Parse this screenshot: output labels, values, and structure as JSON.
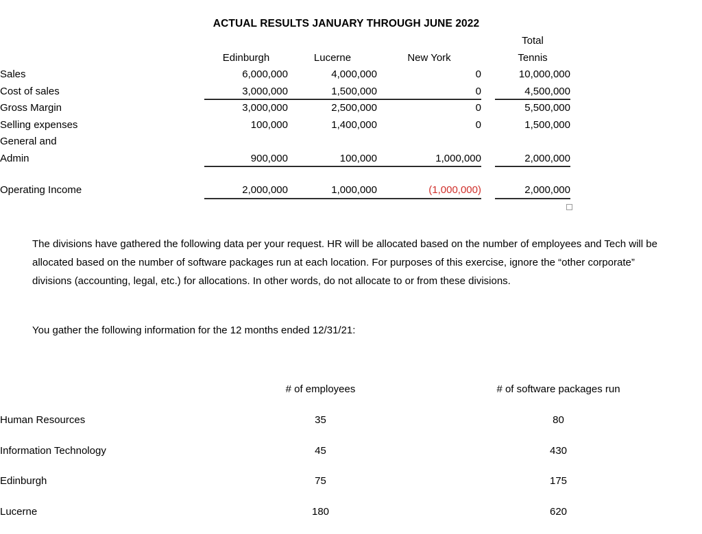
{
  "document": {
    "title": "ACTUAL RESULTS JANUARY THROUGH JUNE 2022"
  },
  "financial_table": {
    "headers": {
      "label": "",
      "edinburgh": "Edinburgh",
      "lucerne": "Lucerne",
      "new_york": "New York",
      "total_line1": "Total",
      "total_line2": "Tennis"
    },
    "rows": [
      {
        "label": "Sales",
        "edinburgh": "6,000,000",
        "lucerne": "4,000,000",
        "new_york": "0",
        "total": "10,000,000",
        "underline": false,
        "negative": false
      },
      {
        "label": "Cost of sales",
        "edinburgh": "3,000,000",
        "lucerne": "1,500,000",
        "new_york": "0",
        "total": "4,500,000",
        "underline": true,
        "negative": false
      },
      {
        "label": "Gross Margin",
        "edinburgh": "3,000,000",
        "lucerne": "2,500,000",
        "new_york": "0",
        "total": "5,500,000",
        "underline": false,
        "negative": false
      },
      {
        "label": "Selling expenses",
        "edinburgh": "100,000",
        "lucerne": "1,400,000",
        "new_york": "0",
        "total": "1,500,000",
        "underline": false,
        "negative": false
      },
      {
        "label": "General and",
        "edinburgh": "",
        "lucerne": "",
        "new_york": "",
        "total": "",
        "underline": false,
        "negative": false
      },
      {
        "label": "Admin",
        "edinburgh": "900,000",
        "lucerne": "100,000",
        "new_york": "1,000,000",
        "total": "2,000,000",
        "underline": true,
        "negative": false
      },
      {
        "label": "Operating Income",
        "edinburgh": "2,000,000",
        "lucerne": "1,000,000",
        "new_york": "(1,000,000)",
        "total": "2,000,000",
        "underline": true,
        "negative": true
      }
    ]
  },
  "paragraphs": {
    "intro": "The divisions have gathered the following data per your request.  HR will be allocated based on the number of employees and Tech will be allocated based on the number of software packages run at each location.  For purposes of this exercise, ignore the “other corporate” divisions (accounting, legal, etc.) for allocations.  In other words, do not allocate to or from these divisions.",
    "lead_in": "You gather the following information for the 12 months ended 12/31/21:"
  },
  "data_table": {
    "headers": {
      "label": "",
      "employees": "# of employees",
      "software": "# of software packages run"
    },
    "rows": [
      {
        "label": "Human Resources",
        "employees": "35",
        "software": "80"
      },
      {
        "label": "Information Technology",
        "employees": "45",
        "software": "430"
      },
      {
        "label": "Edinburgh",
        "employees": "75",
        "software": "175"
      },
      {
        "label": "Lucerne",
        "employees": "180",
        "software": "620"
      }
    ]
  },
  "colors": {
    "negative": "#D0302B",
    "text": "#000000",
    "rule": "#000000",
    "handle_border": "#9A9A9A"
  }
}
